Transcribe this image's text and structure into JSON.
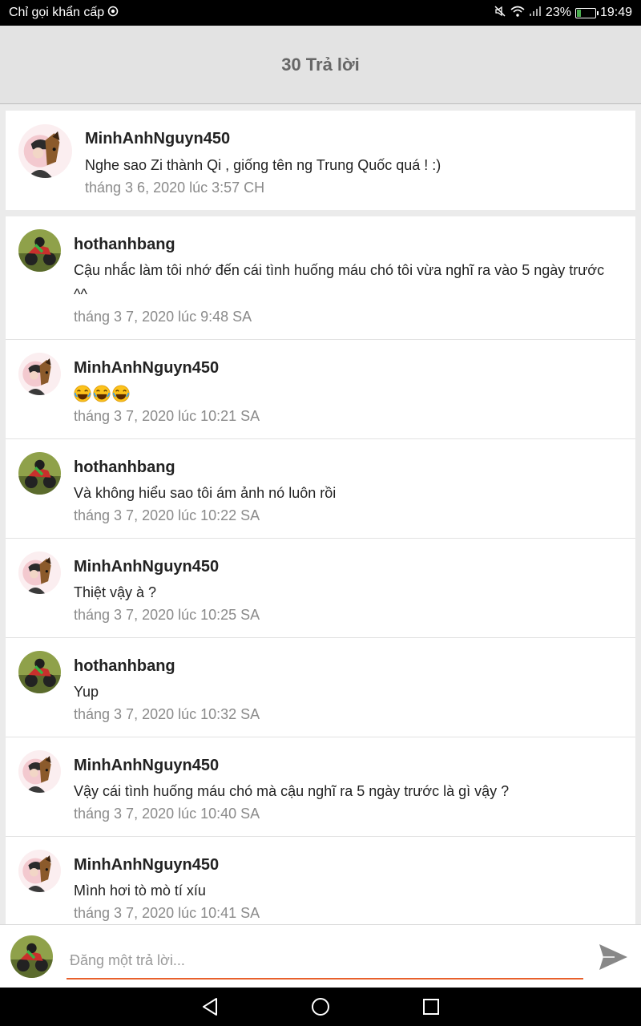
{
  "status_bar": {
    "carrier": "Chỉ gọi khẩn cấp",
    "battery": "23%",
    "battery_level": 0.23,
    "time": "19:49"
  },
  "header": {
    "title": "30 Trả lời"
  },
  "parent_comment": {
    "author": "MinhAnhNguyn450",
    "body": "Nghe sao Zi thành Qi , giống tên ng Trung Quốc quá ! :)",
    "timestamp": "tháng 3 6, 2020 lúc 3:57 CH"
  },
  "replies": [
    {
      "author": "hothanhbang",
      "body": "Cậu nhắc làm tôi nhớ đến cái tình huống máu chó tôi vừa nghĩ ra vào 5 ngày trước ^^",
      "timestamp": "tháng 3 7, 2020 lúc 9:48 SA"
    },
    {
      "author": "MinhAnhNguyn450",
      "body": "😂😂😂",
      "timestamp": "tháng 3 7, 2020 lúc 10:21 SA"
    },
    {
      "author": "hothanhbang",
      "body": "Và không hiểu sao tôi ám ảnh nó luôn rồi",
      "timestamp": "tháng 3 7, 2020 lúc 10:22 SA"
    },
    {
      "author": "MinhAnhNguyn450",
      "body": "Thiệt vậy à ?",
      "timestamp": "tháng 3 7, 2020 lúc 10:25 SA"
    },
    {
      "author": "hothanhbang",
      "body": "Yup",
      "timestamp": "tháng 3 7, 2020 lúc 10:32 SA"
    },
    {
      "author": "MinhAnhNguyn450",
      "body": "Vậy cái tình huống máu chó mà cậu nghĩ ra 5 ngày trước là gì vậy ?",
      "timestamp": "tháng 3 7, 2020 lúc 10:40 SA"
    },
    {
      "author": "MinhAnhNguyn450",
      "body": "Mình hơi tò mò tí xíu",
      "timestamp": "tháng 3 7, 2020 lúc 10:41 SA"
    }
  ],
  "composer": {
    "placeholder": "Đăng một trả lời...",
    "value": ""
  },
  "colors": {
    "accent": "#e8602c",
    "header_bg": "#e3e3e3",
    "muted_text": "#8a8a8a"
  },
  "icons": {
    "alarm": "emergency-circle-icon",
    "mute": "mute-icon",
    "wifi": "wifi-icon",
    "signal": "signal-icon",
    "battery": "battery-icon",
    "send": "send-icon",
    "back": "nav-back-icon",
    "home": "nav-home-icon",
    "recents": "nav-recents-icon"
  }
}
